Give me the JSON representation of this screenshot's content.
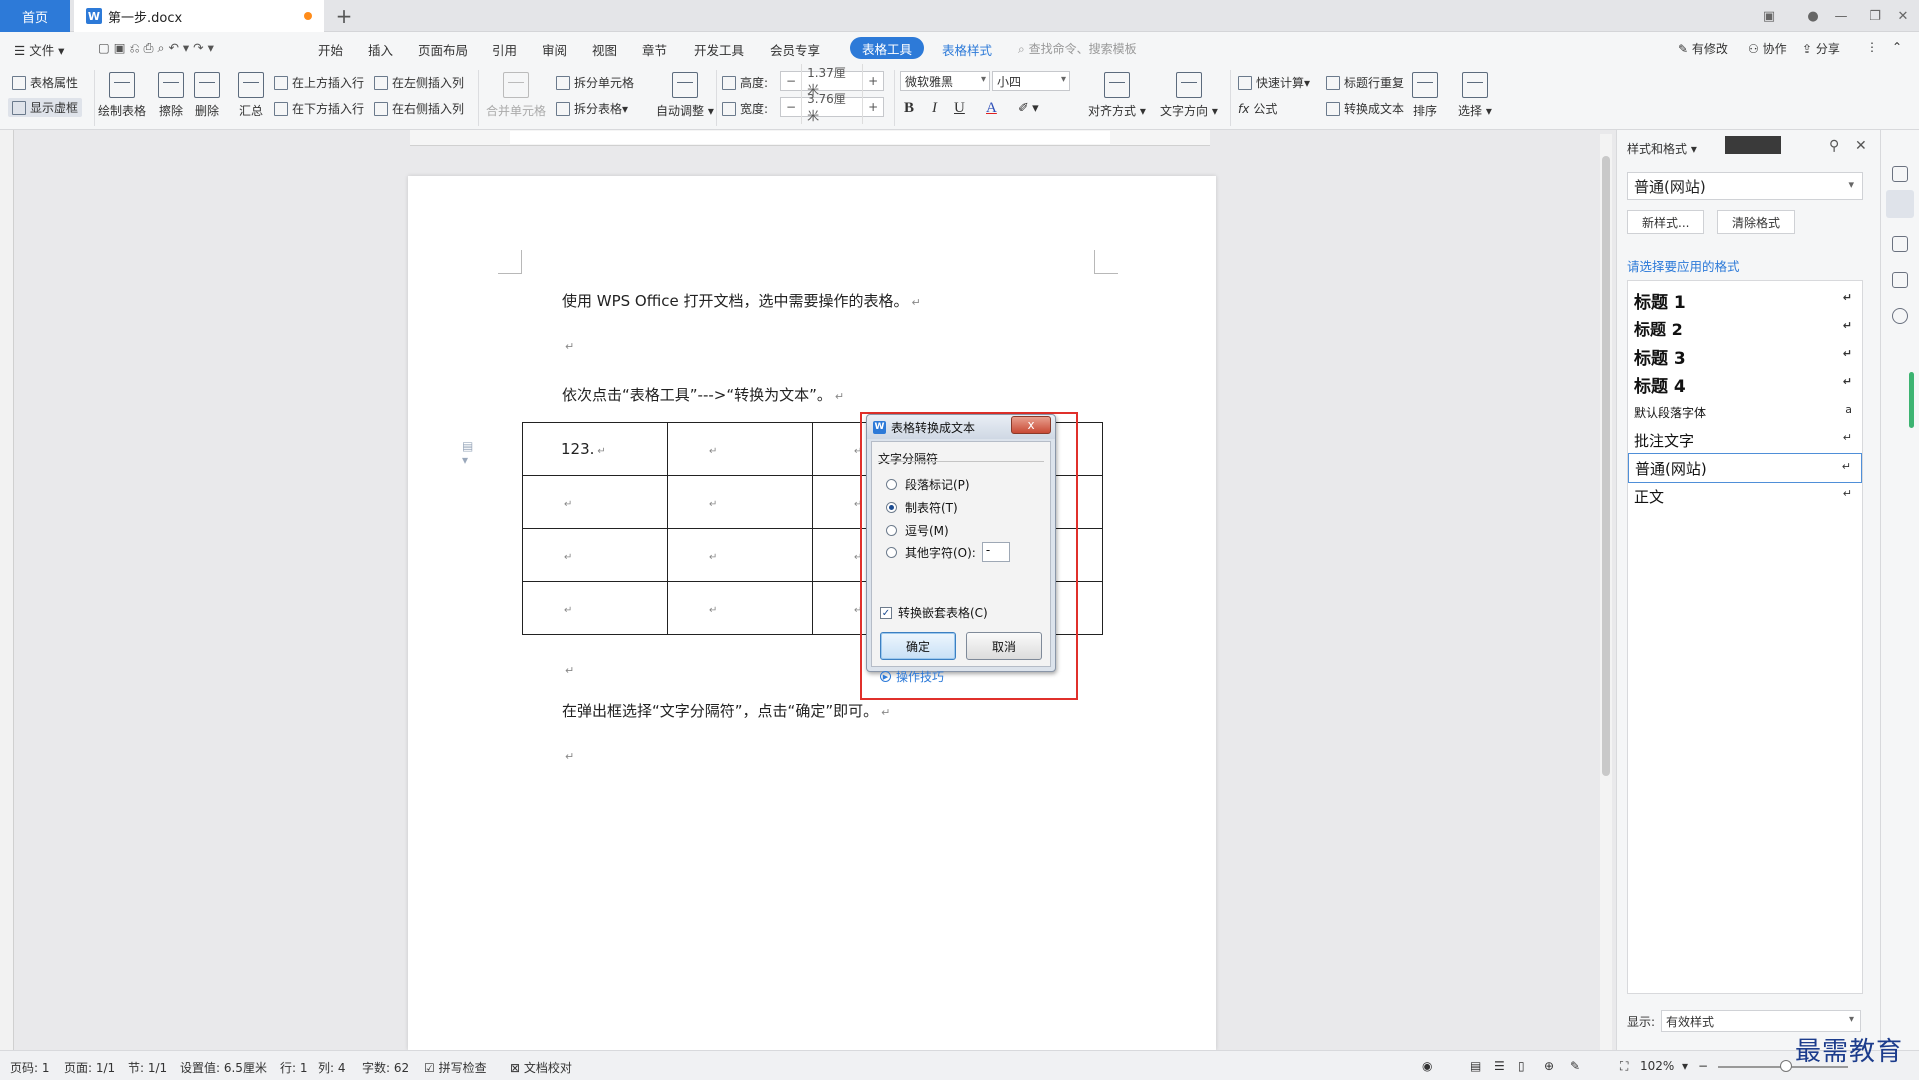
{
  "titlebar": {
    "home_tab": "首页",
    "doc_tab": "第一步.docx",
    "doc_icon": "W",
    "new_tab": "+"
  },
  "menu": {
    "file": "文件",
    "items": [
      "开始",
      "插入",
      "页面布局",
      "引用",
      "审阅",
      "视图",
      "章节",
      "开发工具",
      "会员专享"
    ],
    "active": "表格工具",
    "table_style": "表格样式",
    "search": "查找命令、搜索模板",
    "right": [
      "有修改",
      "协作",
      "分享"
    ]
  },
  "ribbon": {
    "table_props": "表格属性",
    "show_grid": "显示虚框",
    "draw_table": "绘制表格",
    "erase": "擦除",
    "delete": "删除",
    "summary": "汇总",
    "insert_above": "在上方插入行",
    "insert_below": "在下方插入行",
    "insert_left": "在左侧插入列",
    "insert_right": "在右侧插入列",
    "merge_cells": "合并单元格",
    "split_cells": "拆分单元格",
    "split_table": "拆分表格",
    "auto_fit": "自动调整",
    "height_label": "高度:",
    "height_value": "1.37厘米",
    "width_label": "宽度:",
    "width_value": "3.76厘米",
    "font_name": "微软雅黑",
    "font_size": "小四",
    "align": "对齐方式",
    "text_dir": "文字方向",
    "quick_calc": "快速计算",
    "formula": "公式",
    "header_repeat": "标题行重复",
    "to_text": "转换成文本",
    "sort": "排序",
    "select": "选择",
    "bold": "B",
    "italic": "I",
    "underline": "U",
    "font_color": "A",
    "fx": "fx"
  },
  "document": {
    "para1": "使用 WPS Office 打开文档，选中需要操作的表格。",
    "para2": "依次点击“表格工具”--->“转换为文本”。",
    "para3": "在弹出框选择“文字分隔符”，点击“确定”即可。",
    "return_mark": "↵",
    "table_cell_text": "123."
  },
  "dialog": {
    "title": "表格转换成文本",
    "close": "x",
    "group_label": "文字分隔符",
    "options": [
      "段落标记(P)",
      "制表符(T)",
      "逗号(M)",
      "其他字符(O):"
    ],
    "selected_index": 1,
    "other_value": "-",
    "nested_checkbox": "转换嵌套表格(C)",
    "nested_checked": true,
    "ok": "确定",
    "cancel": "取消",
    "tips": "操作技巧"
  },
  "panel": {
    "title": "样式和格式",
    "current_style": "普通(网站)",
    "new_style": "新样式...",
    "clear_format": "清除格式",
    "hint": "请选择要应用的格式",
    "styles": [
      "标题 1",
      "标题 2",
      "标题 3",
      "标题 4",
      "默认段落字体",
      "批注文字",
      "普通(网站)",
      "正文"
    ],
    "selected_style": "普通(网站)",
    "show_label": "显示:",
    "show_value": "有效样式"
  },
  "status": {
    "page_no": "页码: 1",
    "pages": "页面: 1/1",
    "section": "节: 1/1",
    "setting": "设置值: 6.5厘米",
    "row": "行: 1",
    "col": "列: 4",
    "words": "字数: 62",
    "spell": "拼写检查",
    "proof": "文档校对",
    "zoom": "102%"
  },
  "watermark": "最需教育"
}
